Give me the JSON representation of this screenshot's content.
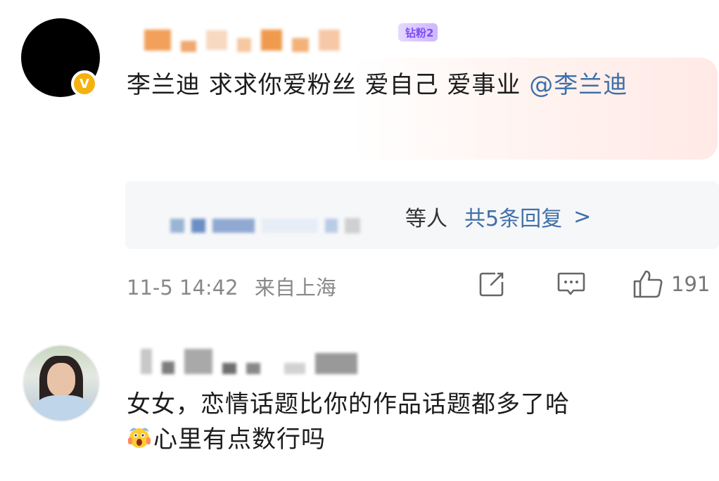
{
  "comment1": {
    "badge_label": "钻粉2",
    "verified_badge": "V",
    "text": "李兰迪 求求你爱粉丝 爱自己 爱事业 ",
    "mention": "@李兰迪",
    "replies_suffix": "等人",
    "replies_count": "共5条回复",
    "replies_chevron": ">",
    "timestamp": "11-5 14:42",
    "location": "来自上海",
    "like_count": "191"
  },
  "comment2": {
    "text_line1": "女女，恋情话题比你的作品话题都多了哈",
    "text_line2": "心里有点数行吗"
  },
  "icons": {
    "share": "share-icon",
    "reply": "comment-icon",
    "like": "thumbs-up-icon",
    "emoji": "scream-emoji-icon"
  },
  "colors": {
    "link": "#3f6fa8",
    "meta": "#888888",
    "badge": "#7d4cf2",
    "verified": "#f5b20f"
  }
}
